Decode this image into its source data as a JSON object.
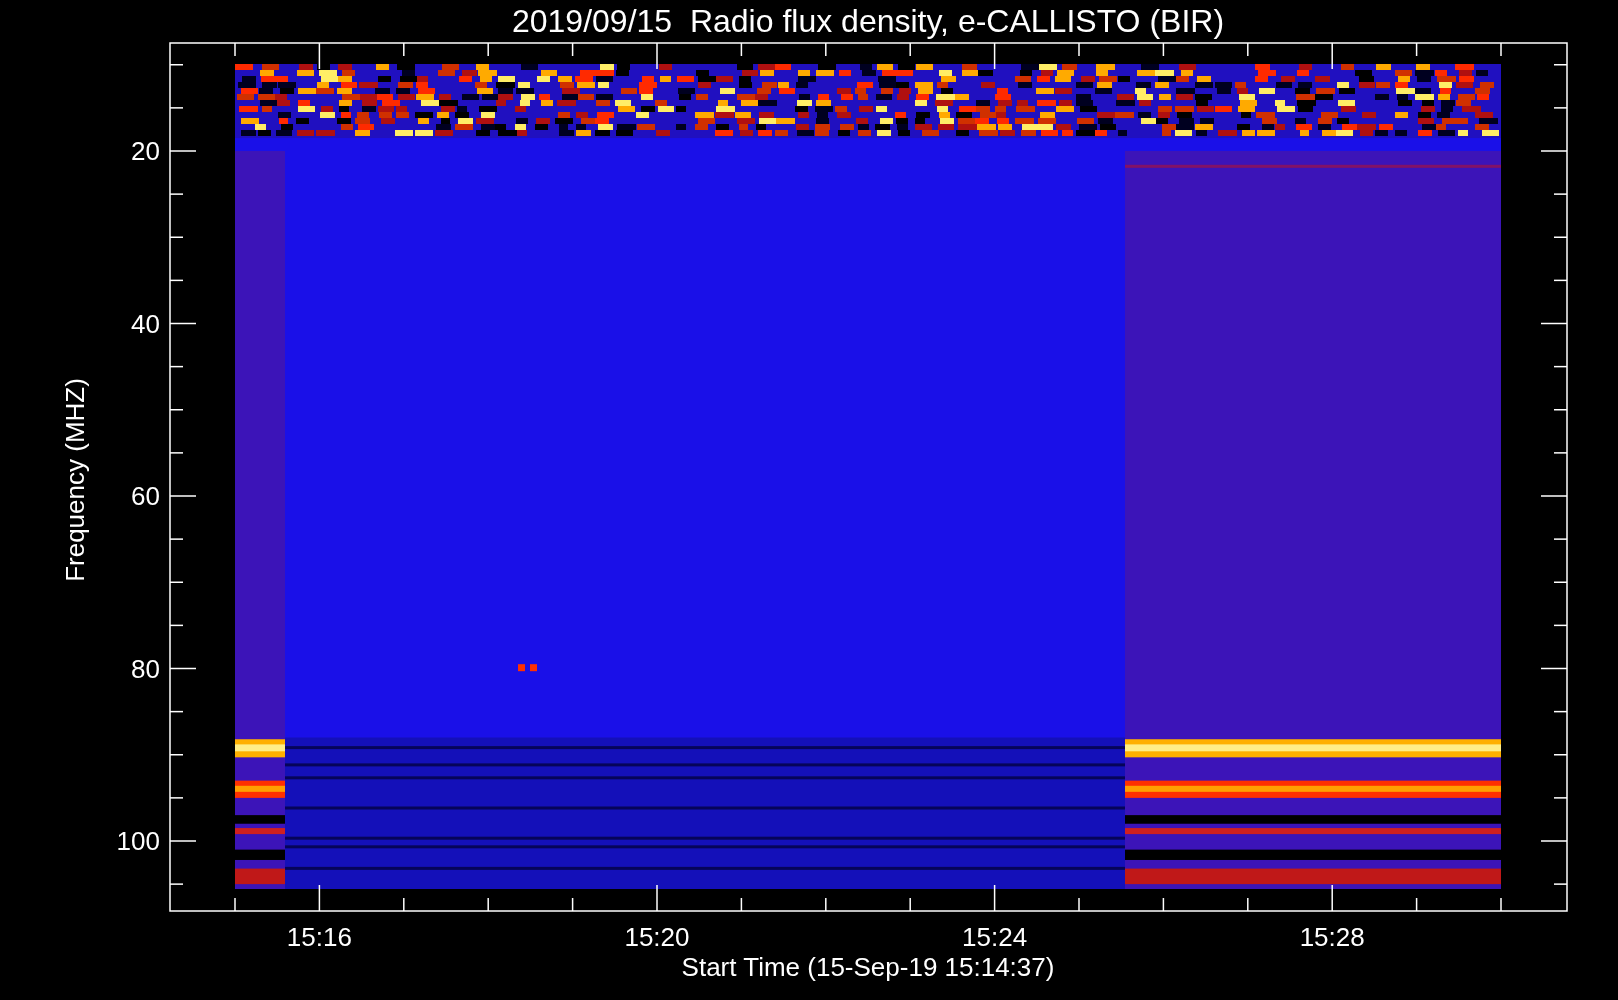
{
  "chart": {
    "title": "2019/09/15  Radio flux density, e-CALLISTO (BIR)",
    "xlabel": "Start Time (15-Sep-19 15:14:37)",
    "ylabel": "Frequency (MHZ)",
    "x_ticks": [
      "15:16",
      "15:20",
      "15:24",
      "15:28"
    ],
    "y_ticks": [
      "20",
      "40",
      "60",
      "80",
      "100"
    ]
  }
}
